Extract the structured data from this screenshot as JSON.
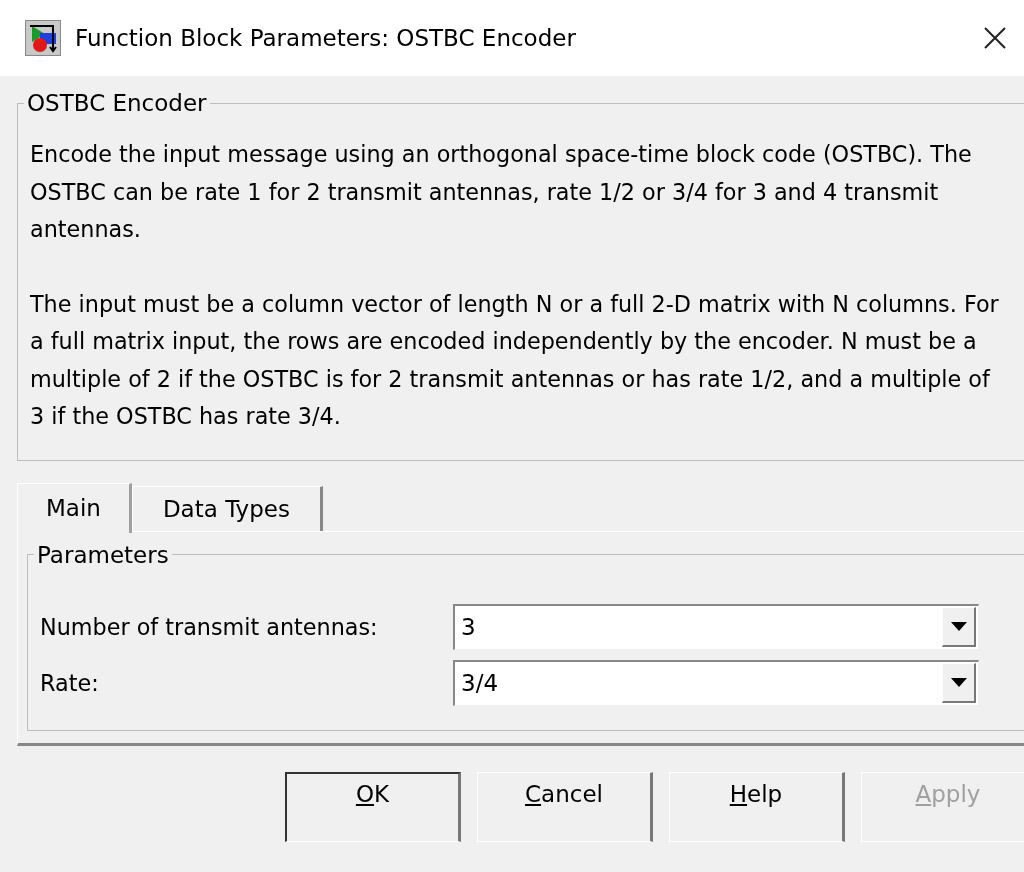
{
  "window": {
    "title": "Function Block Parameters: OSTBC Encoder"
  },
  "description": {
    "title": "OSTBC Encoder",
    "paragraphs": [
      "Encode the input message using an orthogonal space-time block code (OSTBC). The OSTBC can be rate 1 for 2 transmit antennas, rate 1/2 or 3/4 for 3 and 4 transmit antennas.",
      "The input must be a column vector of length N or a full 2-D matrix with N columns. For a full matrix input, the rows are encoded independently by the encoder. N must be a multiple of 2 if the OSTBC is for 2 transmit antennas or has rate 1/2, and a multiple of 3 if the OSTBC has rate 3/4."
    ]
  },
  "tabs": [
    {
      "label": "Main",
      "selected": true
    },
    {
      "label": "Data Types",
      "selected": false
    }
  ],
  "parameters": {
    "title": "Parameters",
    "fields": [
      {
        "label": "Number of transmit antennas:",
        "value": "3"
      },
      {
        "label": "Rate:",
        "value": "3/4"
      }
    ]
  },
  "buttons": [
    {
      "label": "OK",
      "underlined_first": true,
      "disabled": false,
      "default": true
    },
    {
      "label": "Cancel",
      "underlined_first": true,
      "disabled": false,
      "default": false
    },
    {
      "label": "Help",
      "underlined_first": true,
      "disabled": false,
      "default": false
    },
    {
      "label": "Apply",
      "underlined_first": true,
      "disabled": true,
      "default": false
    }
  ]
}
